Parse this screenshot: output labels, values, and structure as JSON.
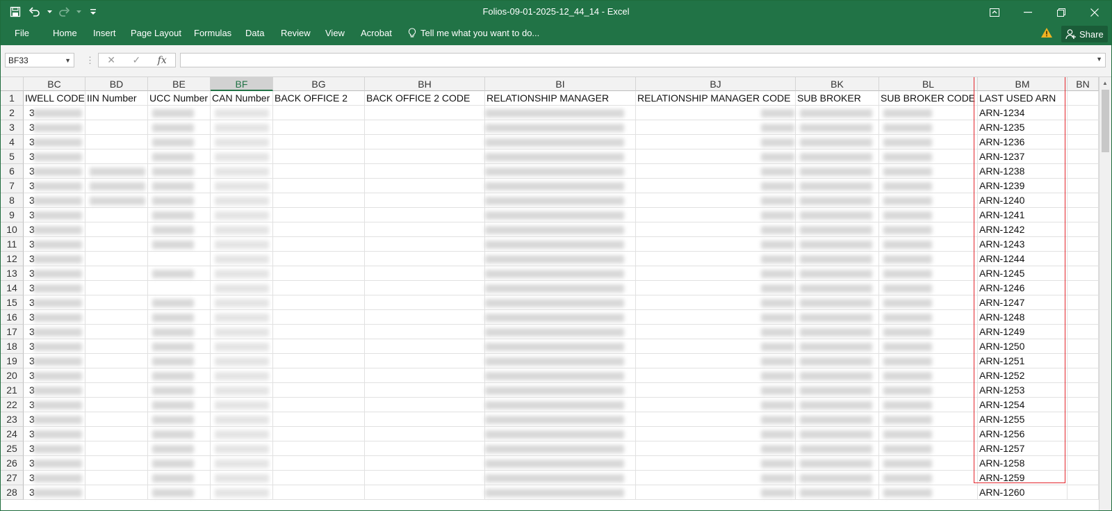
{
  "app": {
    "title": "Folios-09-01-2025-12_44_14 - Excel"
  },
  "ribbon": {
    "tabs": [
      "File",
      "Home",
      "Insert",
      "Page Layout",
      "Formulas",
      "Data",
      "Review",
      "View",
      "Acrobat"
    ],
    "tell_me": "Tell me what you want to do...",
    "share": "Share"
  },
  "formula_bar": {
    "name_box": "BF33",
    "formula": ""
  },
  "grid": {
    "columns": [
      "BC",
      "BD",
      "BE",
      "BF",
      "BG",
      "BH",
      "BI",
      "BJ",
      "BK",
      "BL",
      "BM",
      "BN"
    ],
    "selected_column": "BF",
    "headers": [
      "IWELL CODE",
      "IIN Number",
      "UCC Number",
      "CAN Number",
      "BACK  OFFICE 2",
      "BACK  OFFICE 2 CODE",
      "RELATIONSHIP  MANAGER",
      "RELATIONSHIP  MANAGER CODE",
      "SUB  BROKER",
      "SUB  BROKER CODE",
      "LAST USED ARN",
      ""
    ],
    "row_numbers": [
      "1",
      "2",
      "3",
      "4",
      "5",
      "6",
      "7",
      "8",
      "9",
      "10",
      "11",
      "12",
      "13",
      "14",
      "15",
      "16",
      "17",
      "18",
      "19",
      "20",
      "21",
      "22",
      "23",
      "24",
      "25",
      "26",
      "27",
      "28"
    ],
    "bc_visible_prefix": "3",
    "last_used_arn": [
      "ARN-1234",
      "ARN-1235",
      "ARN-1236",
      "ARN-1237",
      "ARN-1238",
      "ARN-1239",
      "ARN-1240",
      "ARN-1241",
      "ARN-1242",
      "ARN-1243",
      "ARN-1244",
      "ARN-1245",
      "ARN-1246",
      "ARN-1247",
      "ARN-1248",
      "ARN-1249",
      "ARN-1250",
      "ARN-1251",
      "ARN-1252",
      "ARN-1253",
      "ARN-1254",
      "ARN-1255",
      "ARN-1256",
      "ARN-1257",
      "ARN-1258",
      "ARN-1259",
      "ARN-1260"
    ]
  },
  "colors": {
    "excel_green": "#217346",
    "highlight_red": "#e3242b"
  },
  "icons": {
    "save": "save-icon",
    "undo": "undo-icon",
    "redo": "redo-icon",
    "customize": "customize-qat-icon",
    "ribbon_display": "ribbon-display-icon",
    "minimize": "minimize-icon",
    "restore": "restore-icon",
    "close": "close-icon",
    "warning": "warning-icon",
    "share": "share-person-icon",
    "lightbulb": "lightbulb-icon"
  }
}
